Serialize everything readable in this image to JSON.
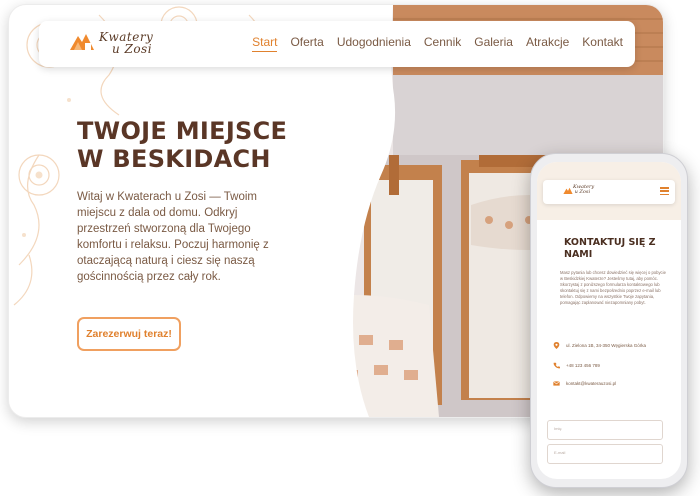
{
  "desktop": {
    "logo": {
      "line1": "Kwatery",
      "line2": "u Zosi"
    },
    "nav": [
      {
        "label": "Start",
        "active": true
      },
      {
        "label": "Oferta",
        "active": false
      },
      {
        "label": "Udogodnienia",
        "active": false
      },
      {
        "label": "Cennik",
        "active": false
      },
      {
        "label": "Galeria",
        "active": false
      },
      {
        "label": "Atrakcje",
        "active": false
      },
      {
        "label": "Kontakt",
        "active": false
      }
    ],
    "hero": {
      "title_line1": "TWOJE MIEJSCE",
      "title_line2": "W BESKIDACH",
      "text": "Witaj w Kwaterach u Zosi — Twoim miejscu z dala od domu. Odkryj przestrzeń stworzoną dla Twojego komfortu i relaksu. Poczuj harmonię z otaczającą naturą i ciesz się naszą gościnnością przez cały rok.",
      "cta": "Zarezerwuj teraz!"
    }
  },
  "mobile": {
    "logo": {
      "line1": "Kwatery",
      "line2": "u Zosi"
    },
    "title": "KONTAKTUJ SIĘ Z NAMI",
    "text": "Masz pytania lub chcesz dowiedzieć się więcej o pobycie w Beskidzkiej Kwaterze? Jesteśmy tutaj, aby pomóc. Skorzystaj z poniższego formularza kontaktowego lub skontaktuj się z nami bezpośrednio poprzez e-mail lub telefon. Odpowiemy na wszystkie Twoje zapytania, pomagając zaplanować niezapomniany pobyt.",
    "address": "ul. Zielona 1B, 34-350 Węgierska Górka",
    "phone": "+48 123 456 789",
    "email": "kontakt@kwaterauzosi.pl",
    "field1_placeholder": "Imię",
    "field2_placeholder": "E-mail"
  },
  "colors": {
    "accent": "#e0812e",
    "brown": "#5a3626",
    "text": "#7a5a44"
  }
}
